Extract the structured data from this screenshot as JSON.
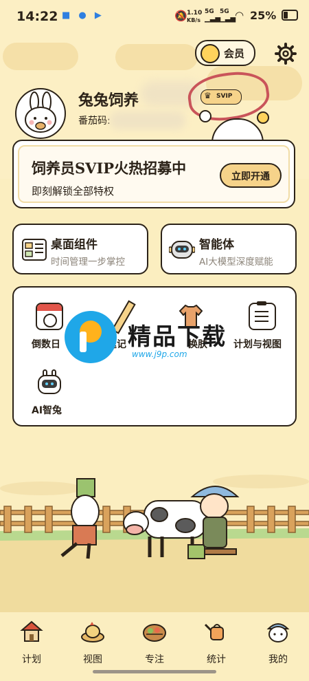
{
  "status_bar": {
    "time": "14:22",
    "net_speed": "1.10",
    "net_unit": "KB/s",
    "signal1": "5G",
    "signal2": "5G",
    "battery": "25%"
  },
  "header": {
    "member_label": "会员",
    "user_name": "兔兔饲养",
    "uid_label": "番茄码:",
    "svip_badge": "SVIP"
  },
  "banner": {
    "title": "饲养员SVIP火热招募中",
    "subtitle": "即刻解锁全部特权",
    "button": "立即开通"
  },
  "cards": [
    {
      "title": "桌面组件",
      "subtitle": "时间管理一步掌控",
      "icon": "widget-icon"
    },
    {
      "title": "智能体",
      "subtitle": "AI大模型深度赋能",
      "icon": "robot-icon"
    }
  ],
  "tools": [
    {
      "label": "倒数日",
      "icon": "calendar-icon"
    },
    {
      "label": "速记",
      "icon": "pencil-icon"
    },
    {
      "label": "换肤",
      "icon": "shirt-icon"
    },
    {
      "label": "计划与视图",
      "icon": "clipboard-icon"
    },
    {
      "label": "AI智兔",
      "icon": "ai-bunny-icon"
    }
  ],
  "watermark": {
    "text": "精品下载",
    "url": "www.j9p.com"
  },
  "nav": [
    {
      "label": "计划",
      "icon": "house-icon"
    },
    {
      "label": "视图",
      "icon": "hen-icon"
    },
    {
      "label": "专注",
      "icon": "basket-icon"
    },
    {
      "label": "统计",
      "icon": "watering-can-icon"
    },
    {
      "label": "我的",
      "icon": "bunny-face-icon"
    }
  ],
  "colors": {
    "background": "#fbeec0",
    "accent": "#f6d38a",
    "outline": "#2b2218",
    "highlight_circle": "#c9545a",
    "watermark_blue": "#1fa7e8"
  }
}
